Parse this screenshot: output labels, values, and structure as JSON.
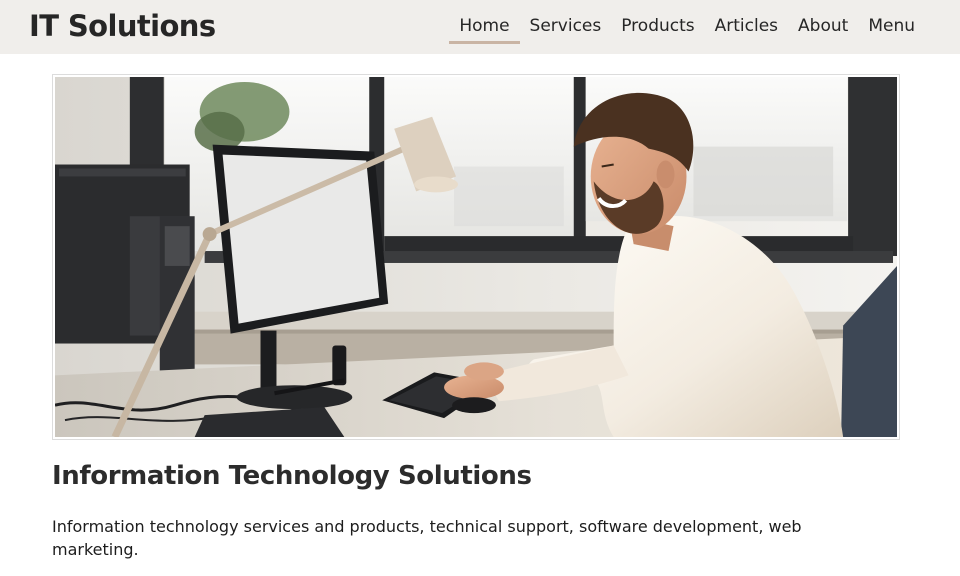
{
  "header": {
    "logo": "IT Solutions",
    "nav": [
      "Home",
      "Services",
      "Products",
      "Articles",
      "About",
      "Menu"
    ],
    "active_nav": "Home"
  },
  "hero": {
    "image_subject": "man smiling while working at a computer desk with monitors and a desk lamp"
  },
  "main": {
    "title": "Information Technology Solutions",
    "intro": "Information technology services and products, technical support, software development, web marketing."
  },
  "colors": {
    "header_bg": "#f0eeeb",
    "active_underline": "#c9b4a4",
    "text": "#1d1d1d"
  }
}
